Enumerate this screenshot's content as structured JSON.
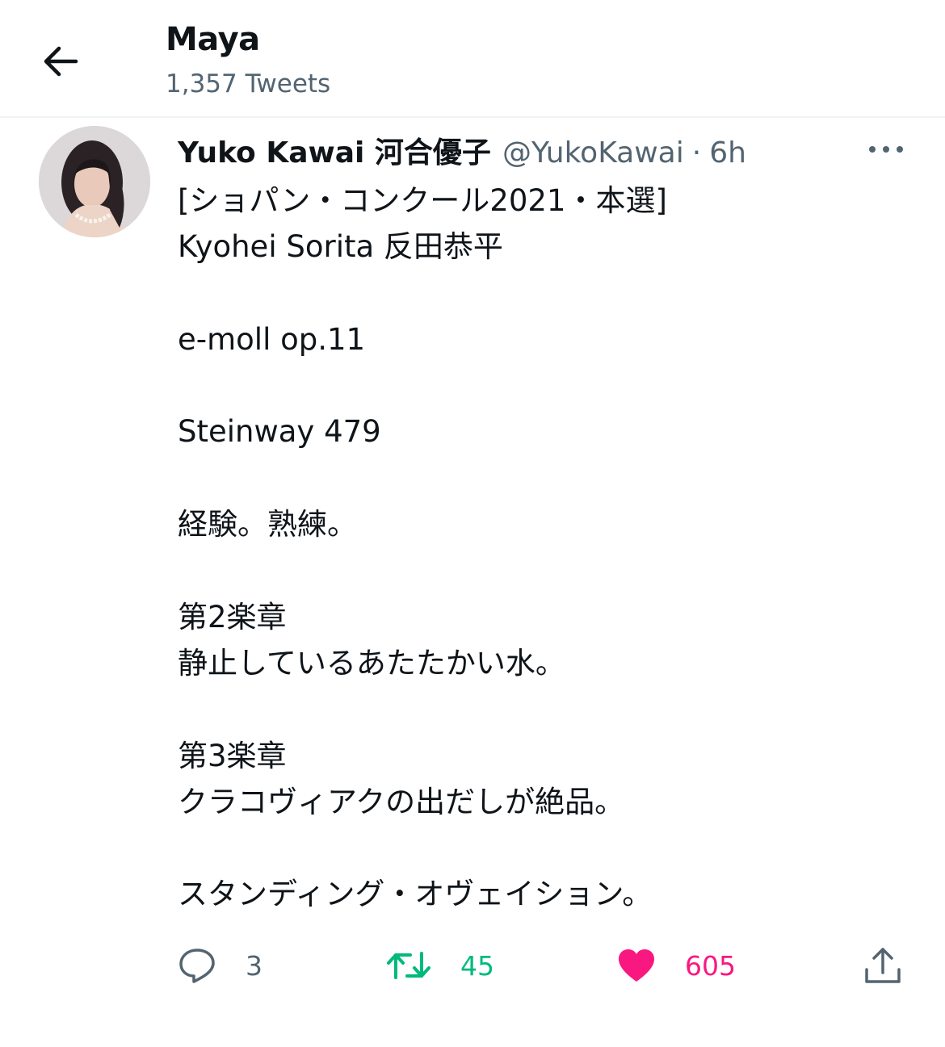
{
  "header": {
    "title": "Maya",
    "subtitle": "1,357 Tweets"
  },
  "tweet": {
    "author_name": "Yuko Kawai 河合優子",
    "handle": "@YukoKawai",
    "separator": "·",
    "time": "6h",
    "text_lines": [
      "[ショパン・コンクール2021・本選]",
      "Kyohei Sorita 反田恭平",
      "",
      "e-moll op.11",
      "",
      "Steinway 479",
      "",
      "経験。熟練。",
      "",
      "第2楽章",
      "静止しているあたたかい水。",
      "",
      "第3楽章",
      "クラコヴィアクの出だしが絶品。",
      "",
      "スタンディング・オヴェイション。"
    ],
    "actions": {
      "replies": "3",
      "retweets": "45",
      "likes": "605"
    }
  },
  "icons": {
    "back": "arrow-left-icon",
    "more": "more-horizontal-icon",
    "reply": "speech-bubble-icon",
    "retweet": "retweet-icon",
    "like": "heart-icon",
    "share": "share-upload-icon"
  },
  "colors": {
    "text": "#0f1419",
    "secondary": "#536471",
    "retweet": "#00ba7c",
    "like": "#f91880",
    "divider": "#eff3f4"
  }
}
